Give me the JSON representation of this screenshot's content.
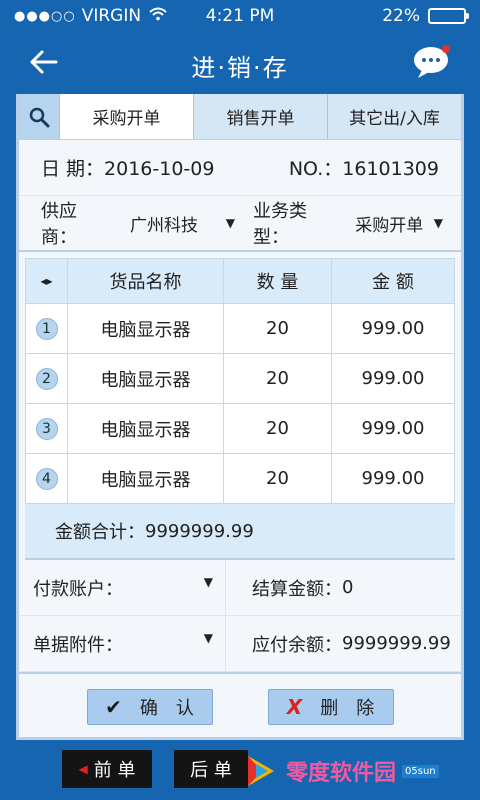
{
  "status_bar": {
    "signal": "●●●○○",
    "carrier": "VIRGIN",
    "time": "4:21 PM",
    "battery_text": "22%",
    "battery_level": 0.22
  },
  "nav": {
    "title": "进·销·存"
  },
  "tabs": [
    {
      "label": "采购开单",
      "active": true
    },
    {
      "label": "销售开单",
      "active": false
    },
    {
      "label": "其它出/入库",
      "active": false
    }
  ],
  "form": {
    "date_label": "日 期：",
    "date_value": "2016-10-09",
    "no_label": "NO.：",
    "no_value": "16101309",
    "supplier_label": "供应商：",
    "supplier_value": "广州科技",
    "biz_type_label": "业务类型：",
    "biz_type_value": "采购开单"
  },
  "table": {
    "col_arrows": "◂▸",
    "columns": [
      "货品名称",
      "数 量",
      "金 额"
    ],
    "rows": [
      {
        "index": "1",
        "name": "电脑显示器",
        "qty": "20",
        "amount": "999.00"
      },
      {
        "index": "2",
        "name": "电脑显示器",
        "qty": "20",
        "amount": "999.00"
      },
      {
        "index": "3",
        "name": "电脑显示器",
        "qty": "20",
        "amount": "999.00"
      },
      {
        "index": "4",
        "name": "电脑显示器",
        "qty": "20",
        "amount": "999.00"
      }
    ]
  },
  "summary": {
    "total_label": "金额合计：",
    "total_value": "9999999.99"
  },
  "payment": {
    "account_label": "付款账户：",
    "settle_label": "结算金额：",
    "settle_value": "0",
    "attach_label": "单据附件：",
    "payable_label": "应付余额：",
    "payable_value": "9999999.99"
  },
  "actions": {
    "confirm_label": "确　认",
    "delete_label": "删　除"
  },
  "bottom": {
    "prev_label": "前 单",
    "next_label": "后 单",
    "watermark_text": "零度软件园",
    "watermark_side": "05sun"
  },
  "colors": {
    "primary": "#1565b0",
    "tab_bg": "#d5e6f5",
    "header_bg": "#d9ebf8",
    "button_bg": "#a9ccee",
    "delete_x": "#d9241b"
  }
}
